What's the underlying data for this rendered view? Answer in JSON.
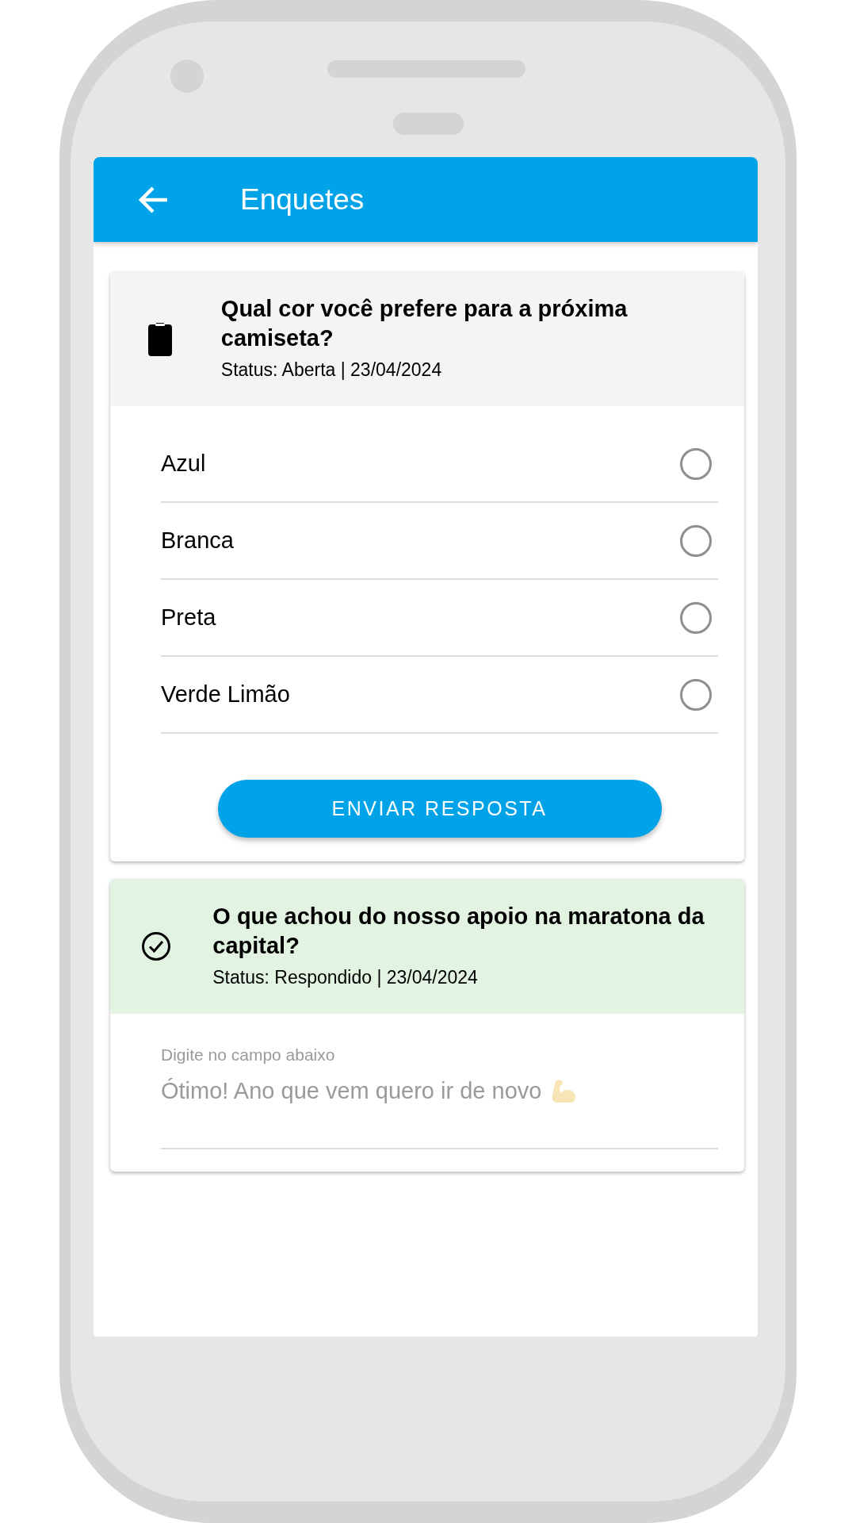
{
  "app_bar": {
    "title": "Enquetes"
  },
  "polls": [
    {
      "kind": "open",
      "title": "Qual cor você prefere para a próxima camiseta?",
      "status": "Status: Aberta | 23/04/2024",
      "options": [
        {
          "label": "Azul",
          "selected": false
        },
        {
          "label": "Branca",
          "selected": false
        },
        {
          "label": "Preta",
          "selected": false
        },
        {
          "label": "Verde Limão",
          "selected": false
        }
      ],
      "button": "ENVIAR RESPOSTA"
    },
    {
      "kind": "answered",
      "title": "O que achou do nosso apoio na maratona da capital?",
      "status": "Status: Respondido | 23/04/2024",
      "field": {
        "label": "Digite no campo abaixo",
        "value": "Ótimo! Ano que vem quero ir de novo",
        "disabled": true
      }
    }
  ]
}
